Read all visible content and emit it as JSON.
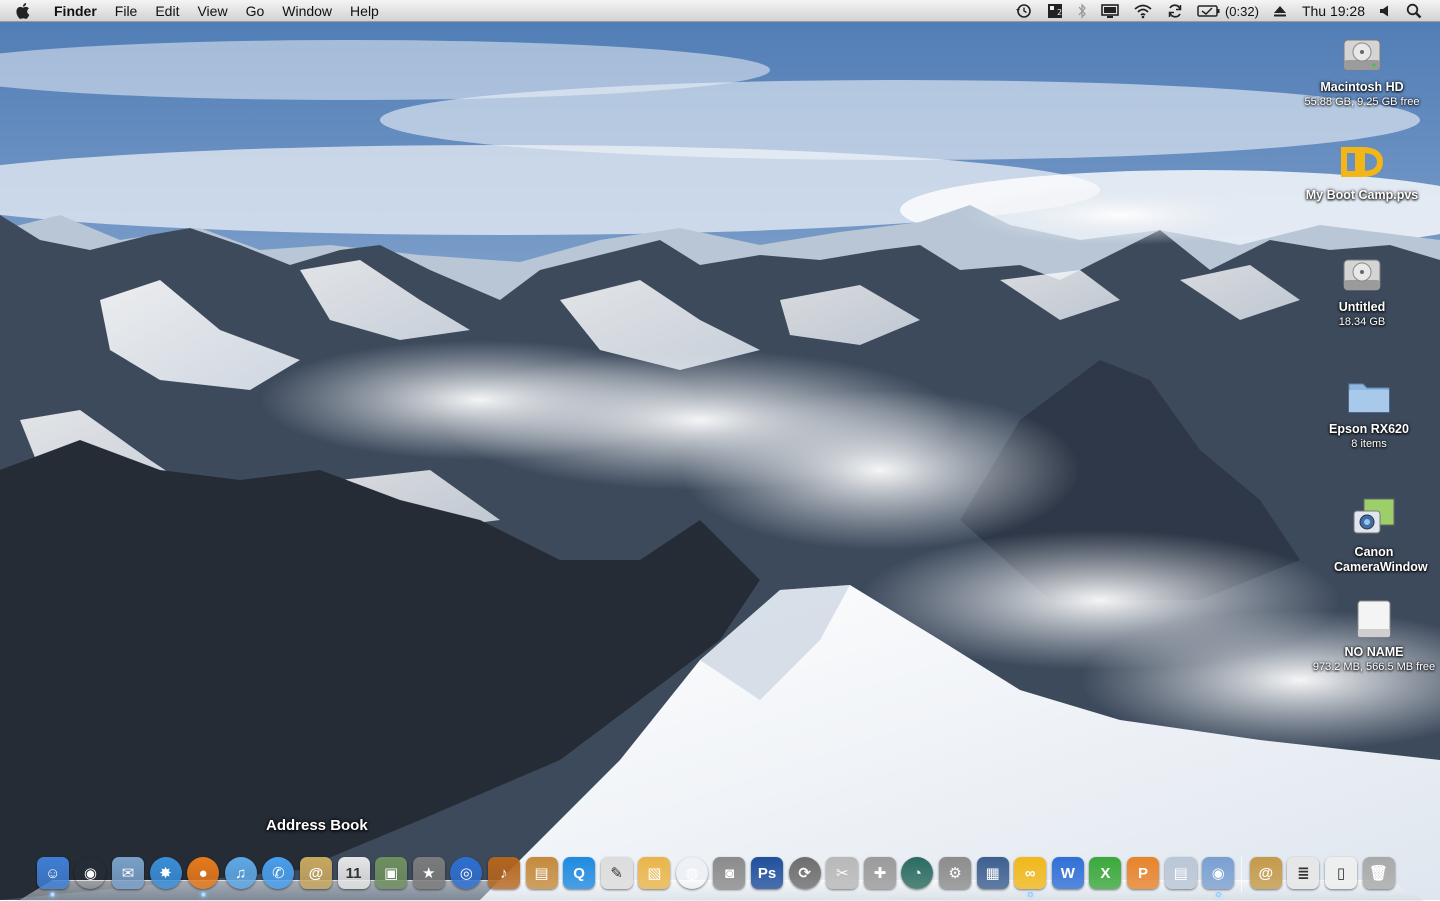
{
  "menubar": {
    "app_name": "Finder",
    "menus": [
      "File",
      "Edit",
      "View",
      "Go",
      "Window",
      "Help"
    ],
    "status_items": [
      "time-machine-icon",
      "spaces-icon",
      "bluetooth-icon",
      "display-icon",
      "wifi-icon",
      "sync-icon",
      "battery-icon"
    ],
    "battery_text": "(0:32)",
    "clock": "Thu 19:28"
  },
  "desktop_icons": [
    {
      "label": "Macintosh HD",
      "sub": "55.88 GB, 9.25 GB free",
      "icon": "hard-drive-icon"
    },
    {
      "label": "My Boot Camp.pvs",
      "sub": "",
      "icon": "parallels-icon"
    },
    {
      "label": "Untitled",
      "sub": "18.34 GB",
      "icon": "hard-drive-icon"
    },
    {
      "label": "Epson RX620",
      "sub": "8 items",
      "icon": "folder-icon"
    },
    {
      "label": "Canon CameraWindow",
      "sub": "",
      "icon": "camera-window-icon"
    },
    {
      "label": "NO NAME",
      "sub": "973.2 MB, 566.5 MB free",
      "icon": "removable-disk-icon"
    }
  ],
  "dock": {
    "tooltip": "Address Book",
    "apps": [
      {
        "name": "finder",
        "color": "#3f7fd6",
        "glyph": "☺"
      },
      {
        "name": "dashboard",
        "color": "#444",
        "glyph": "◉"
      },
      {
        "name": "mail",
        "color": "#7aa1c9",
        "glyph": "✉"
      },
      {
        "name": "safari",
        "color": "#3a8fd9",
        "glyph": "✸"
      },
      {
        "name": "firefox",
        "color": "#e87a1c",
        "glyph": "●"
      },
      {
        "name": "itunes",
        "color": "#5fa9e6",
        "glyph": "♫"
      },
      {
        "name": "ichat",
        "color": "#4aa0ee",
        "glyph": "✆"
      },
      {
        "name": "address-book",
        "color": "#c9a85f",
        "glyph": "@"
      },
      {
        "name": "ical",
        "color": "#e6e6e6",
        "glyph": "11"
      },
      {
        "name": "iphoto",
        "color": "#6f8f5f",
        "glyph": "▣"
      },
      {
        "name": "imovie",
        "color": "#7b7b7b",
        "glyph": "★"
      },
      {
        "name": "idvd",
        "color": "#2d6fcf",
        "glyph": "◎"
      },
      {
        "name": "garageband",
        "color": "#b5651d",
        "glyph": "♪"
      },
      {
        "name": "iweb",
        "color": "#c48a3c",
        "glyph": "▤"
      },
      {
        "name": "quicktime",
        "color": "#1f8ae0",
        "glyph": "Q"
      },
      {
        "name": "textedit",
        "color": "#dcdcdc",
        "glyph": "✎"
      },
      {
        "name": "stuffit",
        "color": "#e9b54a",
        "glyph": "▧"
      },
      {
        "name": "dvd-player",
        "color": "#555",
        "glyph": "◍"
      },
      {
        "name": "image-capture",
        "color": "#8a8a8a",
        "glyph": "◙"
      },
      {
        "name": "photoshop",
        "color": "#1f4f9c",
        "glyph": "Ps"
      },
      {
        "name": "software-update",
        "color": "#6d6d6d",
        "glyph": "⟳"
      },
      {
        "name": "preview",
        "color": "#b8b8b8",
        "glyph": "✂"
      },
      {
        "name": "disk-utility",
        "color": "#9a9a9a",
        "glyph": "✚"
      },
      {
        "name": "time-machine",
        "color": "#2a6b5f",
        "glyph": "◔"
      },
      {
        "name": "system-preferences",
        "color": "#8c8c8c",
        "glyph": "⚙"
      },
      {
        "name": "spaces",
        "color": "#3d5f8f",
        "glyph": "▦"
      },
      {
        "name": "parallels",
        "color": "#f0b81a",
        "glyph": "∞"
      },
      {
        "name": "word",
        "color": "#2f6fd6",
        "glyph": "W"
      },
      {
        "name": "excel",
        "color": "#3aa83a",
        "glyph": "X"
      },
      {
        "name": "powerpoint",
        "color": "#e8832a",
        "glyph": "P"
      },
      {
        "name": "applications-stack",
        "color": "#b9c6d6",
        "glyph": "▤"
      },
      {
        "name": "canon-camera-window",
        "color": "#7aa0d0",
        "glyph": "◉"
      }
    ],
    "stacks": [
      {
        "name": "address-stack",
        "color": "#c49a4a",
        "glyph": "@"
      },
      {
        "name": "documents-stack",
        "color": "#e6e6e6",
        "glyph": "≣"
      },
      {
        "name": "downloads-stack",
        "color": "#eeeeee",
        "glyph": "▯"
      },
      {
        "name": "trash",
        "color": "#a9a9a9",
        "glyph": "🗑"
      }
    ]
  }
}
